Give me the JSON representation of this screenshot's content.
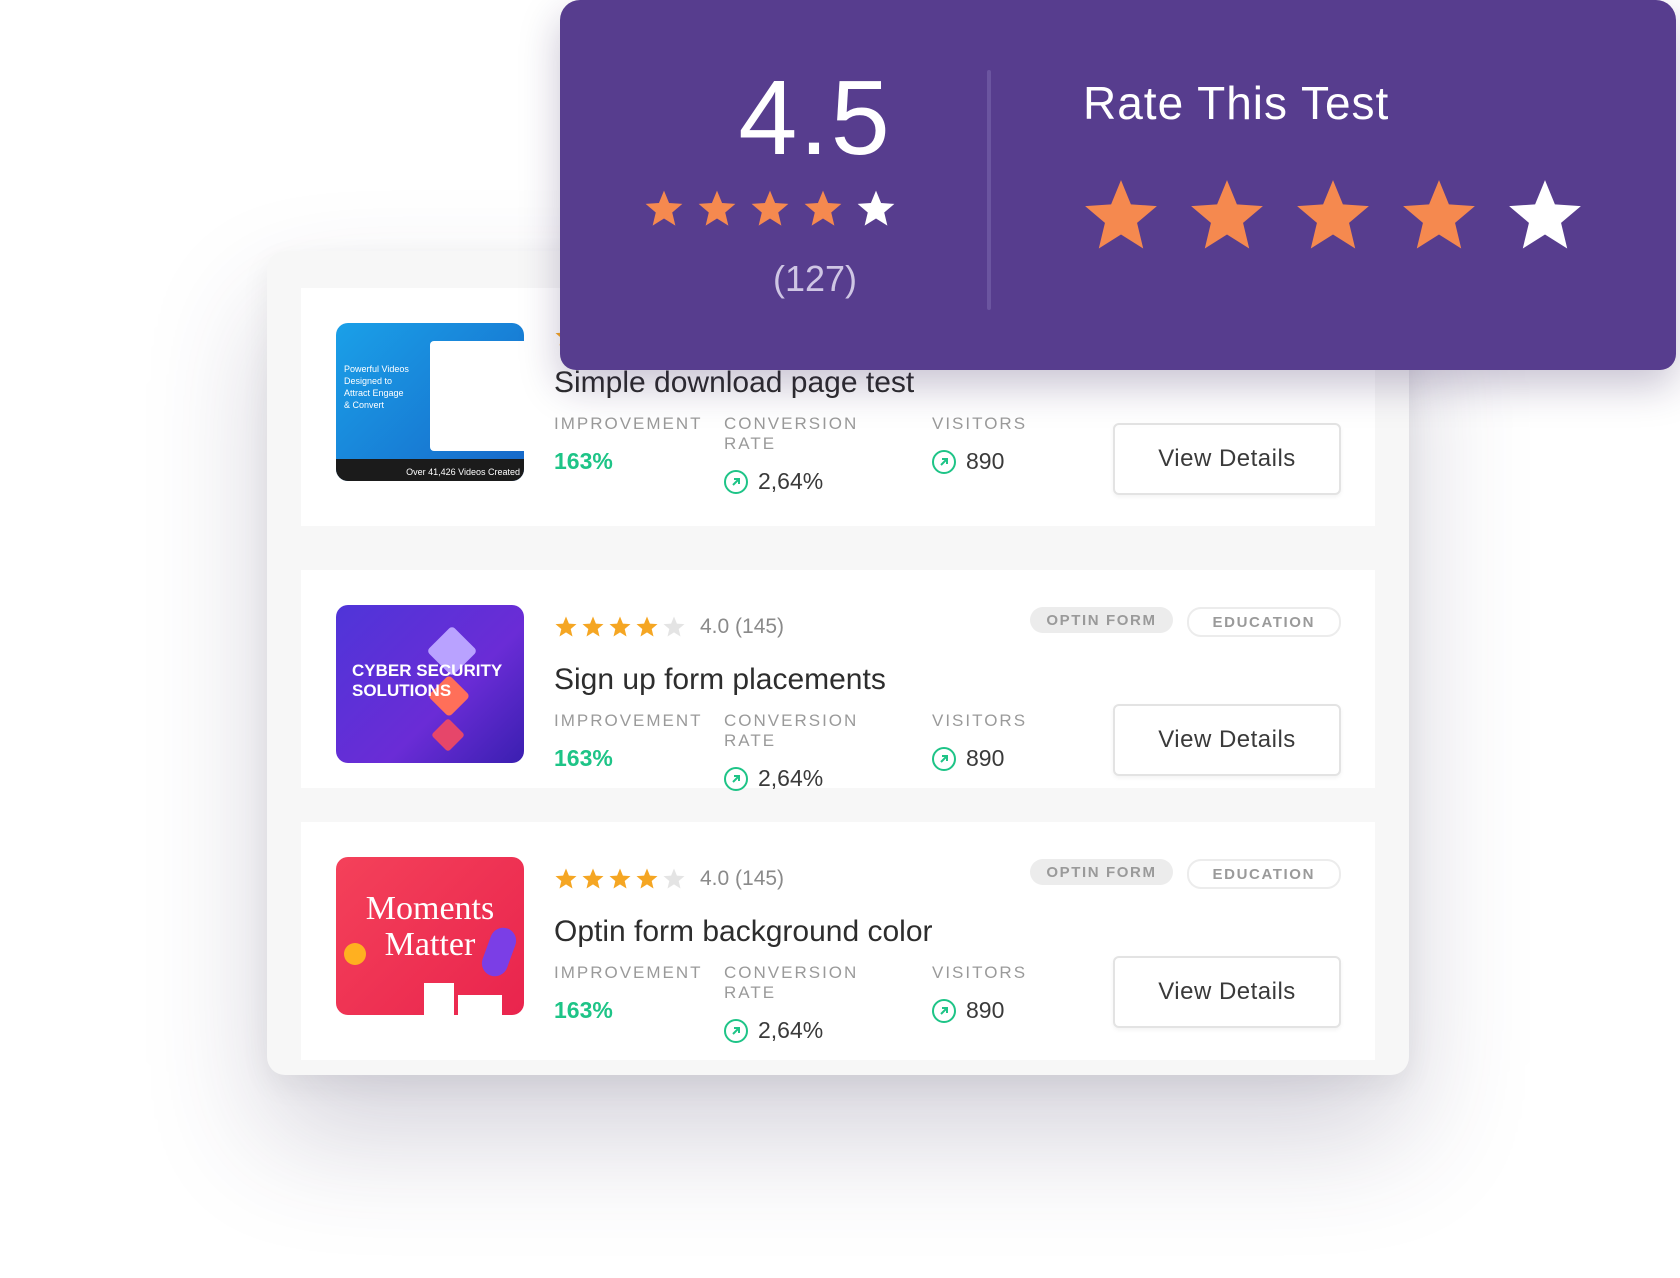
{
  "colors": {
    "accent": "#573d8e",
    "star": "#f5894f",
    "star_small": "#f5a623",
    "green": "#1ec487"
  },
  "summary": {
    "score": "4.5",
    "count": "(127)",
    "stars": [
      1,
      1,
      1,
      1,
      0
    ],
    "rate_title": "Rate This Test",
    "rate_stars": [
      1,
      1,
      1,
      1,
      0
    ]
  },
  "tests": [
    {
      "title": "Simple download page test",
      "rating_text": "",
      "stars": [
        1,
        1,
        1,
        1,
        0
      ],
      "tags": [],
      "thumb_text": [
        "Powerful Videos",
        "Designed to",
        "Attract Engage",
        "& Convert",
        "Over 41,426 Videos Created"
      ],
      "improvement_label": "IMPROVEMENT",
      "improvement": "163%",
      "conversion_label": "CONVERSION RATE",
      "conversion": "2,64%",
      "visitors_label": "VISITORS",
      "visitors": "890",
      "button": "View Details"
    },
    {
      "title": "Sign up form placements",
      "rating_text": "4.0 (145)",
      "stars": [
        1,
        1,
        1,
        1,
        0
      ],
      "tags": [
        "OPTIN FORM",
        "EDUCATION"
      ],
      "thumb_text": [
        "CYBER SECURITY",
        "SOLUTIONS"
      ],
      "improvement_label": "IMPROVEMENT",
      "improvement": "163%",
      "conversion_label": "CONVERSION RATE",
      "conversion": "2,64%",
      "visitors_label": "VISITORS",
      "visitors": "890",
      "button": "View Details"
    },
    {
      "title": "Optin form background color",
      "rating_text": "4.0 (145)",
      "stars": [
        1,
        1,
        1,
        1,
        0
      ],
      "tags": [
        "OPTIN FORM",
        "EDUCATION"
      ],
      "thumb_text": [
        "Moments",
        "Matter"
      ],
      "improvement_label": "IMPROVEMENT",
      "improvement": "163%",
      "conversion_label": "CONVERSION RATE",
      "conversion": "2,64%",
      "visitors_label": "VISITORS",
      "visitors": "890",
      "button": "View Details"
    }
  ]
}
